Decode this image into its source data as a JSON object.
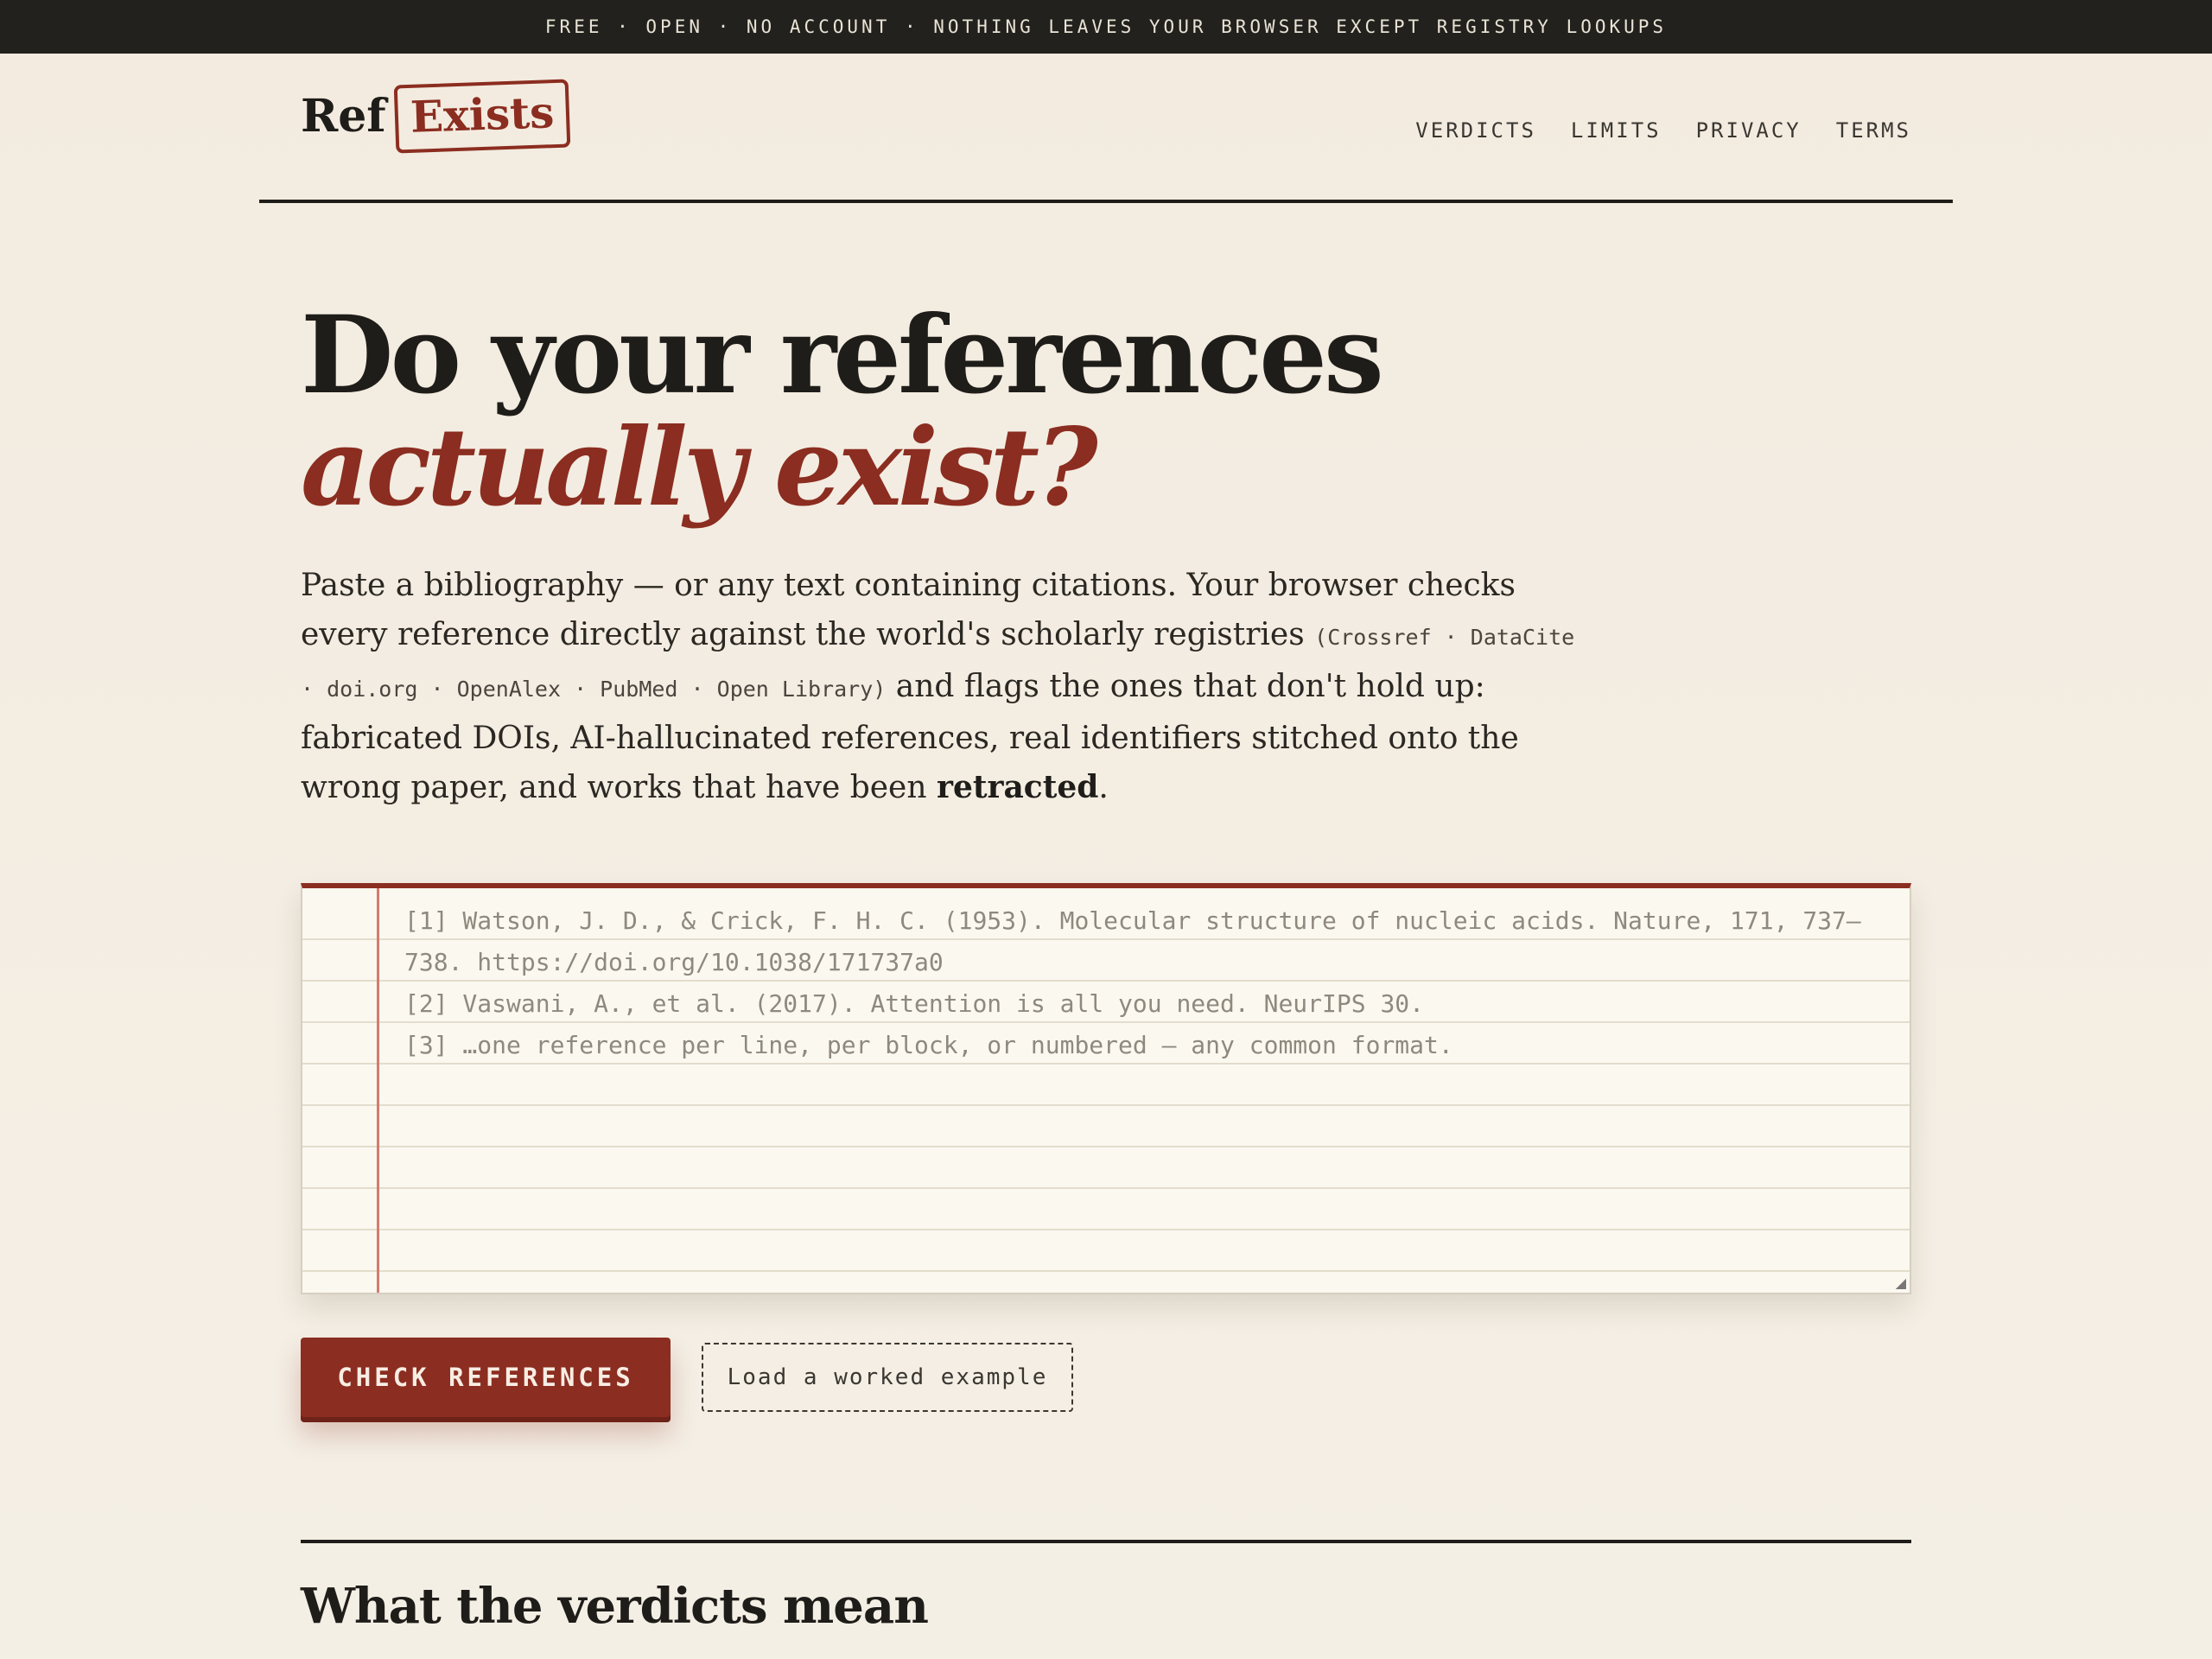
{
  "topbar": {
    "text": "FREE · OPEN · NO ACCOUNT · NOTHING LEAVES YOUR BROWSER EXCEPT REGISTRY LOOKUPS"
  },
  "header": {
    "logo_ref": "Ref",
    "logo_exists": "Exists",
    "nav": [
      "VERDICTS",
      "LIMITS",
      "PRIVACY",
      "TERMS"
    ]
  },
  "hero": {
    "title_line1": "Do your references",
    "title_line2": "actually exist?",
    "lead_part1": "Paste a bibliography — or any text containing citations. Your browser checks every reference directly against the world's scholarly registries ",
    "lead_registries": "(Crossref · DataCite · doi.org · OpenAlex · PubMed · Open Library)",
    "lead_part2": " and flags the ones that don't hold up: fabricated DOIs, AI-hallucinated references, real identifiers stitched onto the wrong paper, and works that have been ",
    "lead_bold": "retracted",
    "lead_end": "."
  },
  "editor": {
    "placeholder_lines": [
      "[1] Watson, J. D., & Crick, F. H. C. (1953). Molecular structure of nucleic acids. Nature, 171, 737–738. https://doi.org/10.1038/171737a0",
      "[2] Vaswani, A., et al. (2017). Attention is all you need. NeurIPS 30.",
      "[3] …one reference per line, per block, or numbered — any common format."
    ]
  },
  "actions": {
    "check_label": "CHECK REFERENCES",
    "example_label": "Load a worked example"
  },
  "section": {
    "title": "What the verdicts mean"
  },
  "colors": {
    "accent": "#8b2d20",
    "ink": "#1f1d19",
    "paper": "#f4efe5",
    "topbar": "#23211d"
  }
}
